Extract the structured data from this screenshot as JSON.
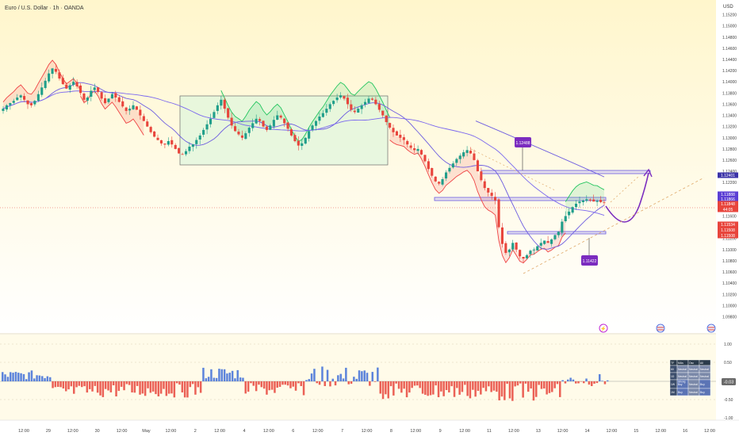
{
  "chart_title": "Euro / U.S. Dollar · 1h · OANDA",
  "currency_label": "USD",
  "colors": {
    "bull": "#3f6fd8",
    "bear": "#e8453c",
    "accent": "#7b2cbf",
    "ma": "#7b68ee",
    "band_green": "#22c55e",
    "band_red": "#ef4444"
  },
  "price_axis": {
    "ticks": [
      "1.15200",
      "1.15000",
      "1.14800",
      "1.14600",
      "1.14400",
      "1.14200",
      "1.14000",
      "1.13800",
      "1.13600",
      "1.13400",
      "1.13200",
      "1.13000",
      "1.12800",
      "1.12600",
      "1.12400",
      "1.12200",
      "1.12000",
      "1.11800",
      "1.11600",
      "1.11400",
      "1.11200",
      "1.11000",
      "1.10800",
      "1.10600",
      "1.10400",
      "1.10200",
      "1.10000",
      "1.09800"
    ],
    "tags": [
      {
        "label": "1.12401",
        "color": "#3b33a8"
      },
      {
        "label": "1.11888",
        "color": "#5b3fd4"
      },
      {
        "label": "1.11866",
        "color": "#5b3fd4"
      },
      {
        "label": "1.11848",
        "color": "#e8453c"
      },
      {
        "label": "44:05",
        "color": "#e8453c"
      },
      {
        "label": "1.11534",
        "color": "#e8453c"
      },
      {
        "label": "1.11508",
        "color": "#e8453c"
      },
      {
        "label": "1.11508",
        "color": "#e8453c"
      }
    ]
  },
  "osc_axis": {
    "ticks": [
      "1.00",
      "0.50",
      "0.00",
      "-0.50",
      "-1.00"
    ],
    "current": "-0.03"
  },
  "time_axis": [
    "12:00",
    "29",
    "12:00",
    "30",
    "12:00",
    "May",
    "12:00",
    "2",
    "12:00",
    "4",
    "12:00",
    "6",
    "12:00",
    "7",
    "12:00",
    "8",
    "12:00",
    "9",
    "12:00",
    "11",
    "12:00",
    "13",
    "12:00",
    "14",
    "12:00",
    "15",
    "12:00",
    "16",
    "12:00"
  ],
  "callouts": [
    {
      "label": "1.12488"
    },
    {
      "label": "1.11422"
    }
  ],
  "table": {
    "headers": [
      "TF",
      "MAs",
      "Osc",
      "All"
    ],
    "rows": [
      [
        "60",
        "Neutral",
        "Neutral",
        "Neutral"
      ],
      [
        "1D",
        "Neutral",
        "Neutral",
        "Neutral"
      ],
      [
        "1W",
        "Strong Buy",
        "Neutral",
        "Buy"
      ],
      [
        "1M",
        "Buy",
        "Neutral",
        "Buy"
      ]
    ]
  },
  "chart_data": {
    "type": "candlestick",
    "title": "Euro / U.S. Dollar · 1h · OANDA",
    "ylabel": "USD",
    "ylim": [
      1.0975,
      1.1535
    ],
    "close_series": [
      1.1352,
      1.1358,
      1.1362,
      1.1366,
      1.1372,
      1.1376,
      1.1368,
      1.136,
      1.1358,
      1.1366,
      1.1378,
      1.139,
      1.1402,
      1.1415,
      1.1424,
      1.1418,
      1.1406,
      1.1396,
      1.1388,
      1.1394,
      1.14,
      1.1392,
      1.138,
      1.1368,
      1.1372,
      1.1384,
      1.139,
      1.1382,
      1.137,
      1.1362,
      1.137,
      1.1378,
      1.1372,
      1.1364,
      1.1356,
      1.1348,
      1.1352,
      1.1358,
      1.135,
      1.134,
      1.133,
      1.132,
      1.131,
      1.1302,
      1.1296,
      1.129,
      1.1288,
      1.1294,
      1.1288,
      1.128,
      1.1272,
      1.127,
      1.1276,
      1.1284,
      1.1288,
      1.1296,
      1.1304,
      1.1314,
      1.1324,
      1.1334,
      1.1346,
      1.1358,
      1.1368,
      1.1352,
      1.1336,
      1.1322,
      1.1312,
      1.1306,
      1.13,
      1.1308,
      1.1318,
      1.1326,
      1.1334,
      1.133,
      1.132,
      1.1314,
      1.1322,
      1.1332,
      1.134,
      1.1336,
      1.1326,
      1.1316,
      1.1304,
      1.1294,
      1.1286,
      1.129,
      1.13,
      1.1312,
      1.1322,
      1.133,
      1.1338,
      1.1344,
      1.1352,
      1.136,
      1.1366,
      1.1372,
      1.1376,
      1.137,
      1.136,
      1.135,
      1.1346,
      1.1352,
      1.1358,
      1.1364,
      1.137,
      1.1368,
      1.136,
      1.135,
      1.134,
      1.1328,
      1.1318,
      1.131,
      1.1304,
      1.13,
      1.1296,
      1.1288,
      1.1282,
      1.1278,
      1.128,
      1.127,
      1.1258,
      1.1244,
      1.1232,
      1.1222,
      1.1218,
      1.1226,
      1.1238,
      1.1246,
      1.1254,
      1.1262,
      1.1268,
      1.1274,
      1.1278,
      1.1272,
      1.126,
      1.124,
      1.1224,
      1.121,
      1.1202,
      1.1196,
      1.1188,
      1.114,
      1.111,
      1.1094,
      1.11,
      1.1112,
      1.11,
      1.1088,
      1.1084,
      1.109,
      1.1098,
      1.11,
      1.1106,
      1.1112,
      1.1116,
      1.1112,
      1.1118,
      1.1126,
      1.1132,
      1.115,
      1.116,
      1.1168,
      1.1176,
      1.1182,
      1.1186,
      1.1188,
      1.119,
      1.1188,
      1.1186,
      1.1187,
      1.1185,
      1.1184
    ]
  }
}
